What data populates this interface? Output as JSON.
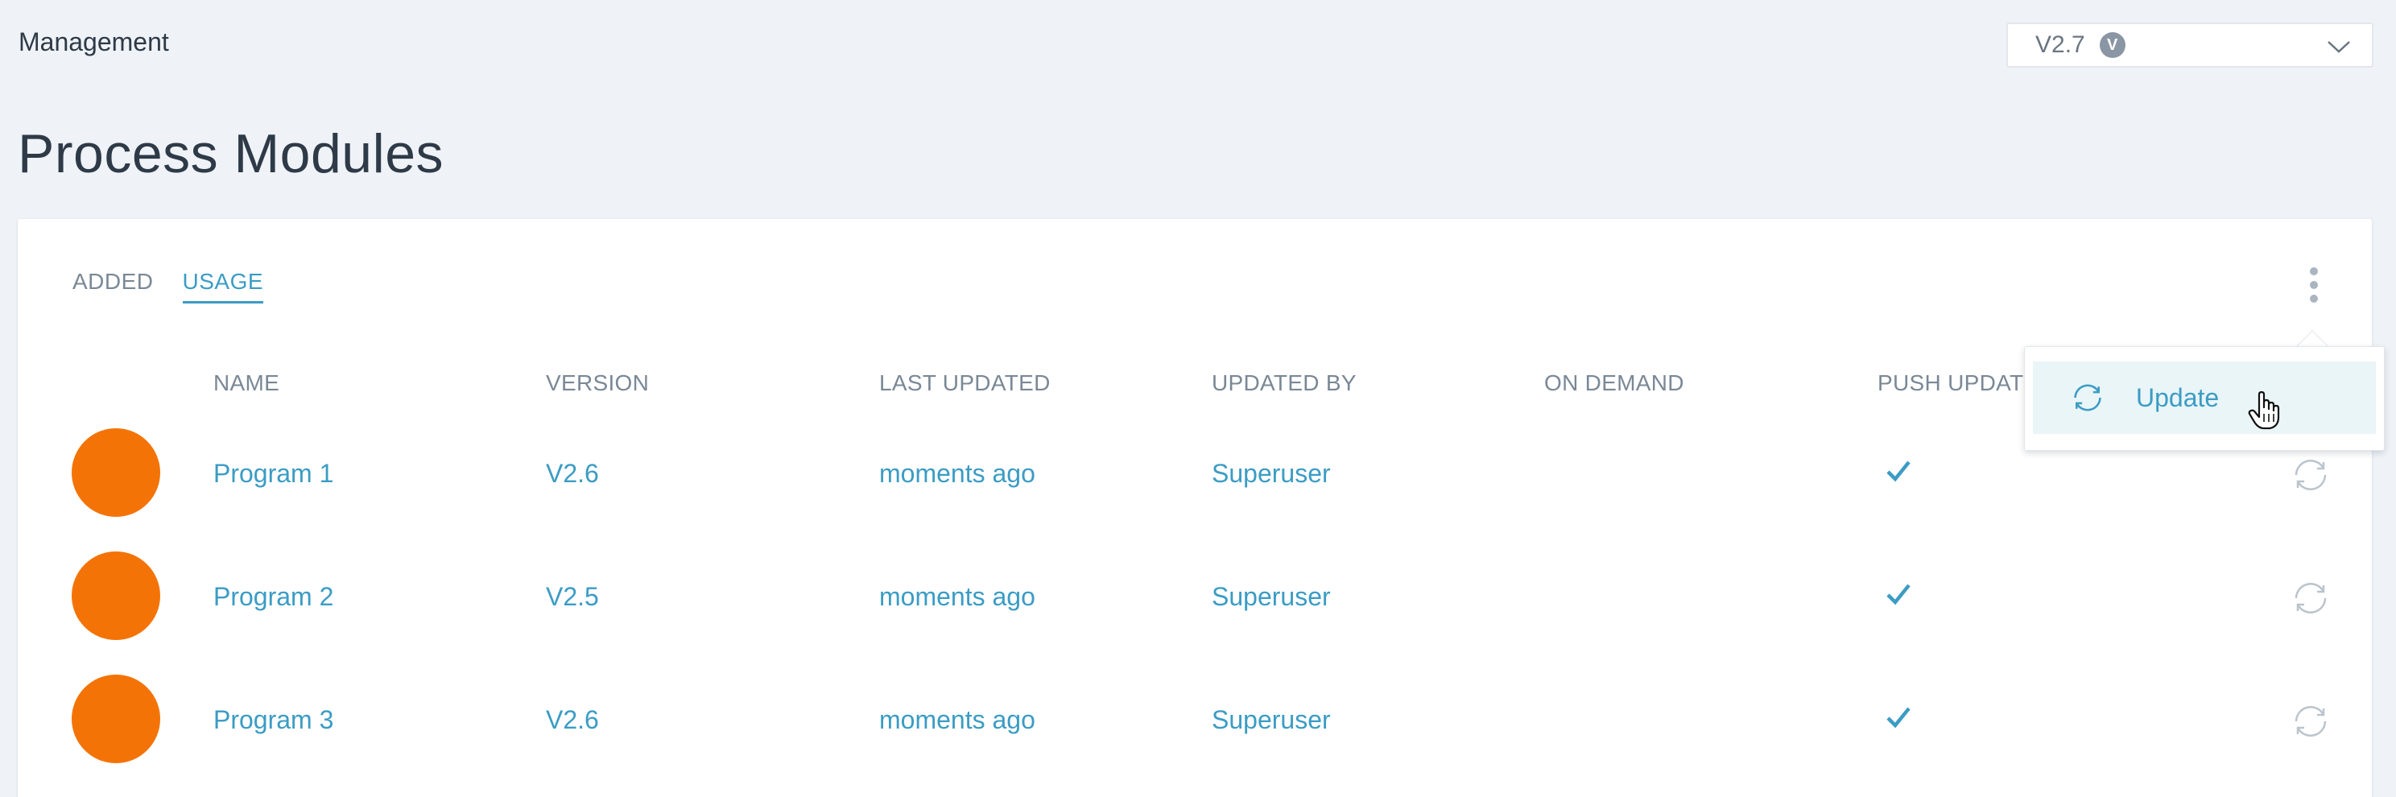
{
  "header": {
    "breadcrumb": "Management",
    "version_select": {
      "value": "V2.7",
      "badge": "V"
    },
    "title": "Process Modules"
  },
  "tabs": [
    {
      "label": "ADDED",
      "active": false
    },
    {
      "label": "USAGE",
      "active": true
    }
  ],
  "table": {
    "columns": [
      "NAME",
      "VERSION",
      "LAST UPDATED",
      "UPDATED BY",
      "ON DEMAND",
      "PUSH UPDATE"
    ],
    "rows": [
      {
        "name": "Program 1",
        "version": "V2.6",
        "last_updated": "moments ago",
        "updated_by": "Superuser",
        "on_demand": "",
        "push_update": true
      },
      {
        "name": "Program 2",
        "version": "V2.5",
        "last_updated": "moments ago",
        "updated_by": "Superuser",
        "on_demand": "",
        "push_update": true
      },
      {
        "name": "Program 3",
        "version": "V2.6",
        "last_updated": "moments ago",
        "updated_by": "Superuser",
        "on_demand": "",
        "push_update": true
      }
    ]
  },
  "menu": {
    "items": [
      {
        "label": "Update",
        "icon": "sync-icon"
      }
    ]
  },
  "colors": {
    "accent": "#3b9cc4",
    "avatar": "#f47306",
    "background": "#eff3f7",
    "muted_text": "#7a8896"
  }
}
